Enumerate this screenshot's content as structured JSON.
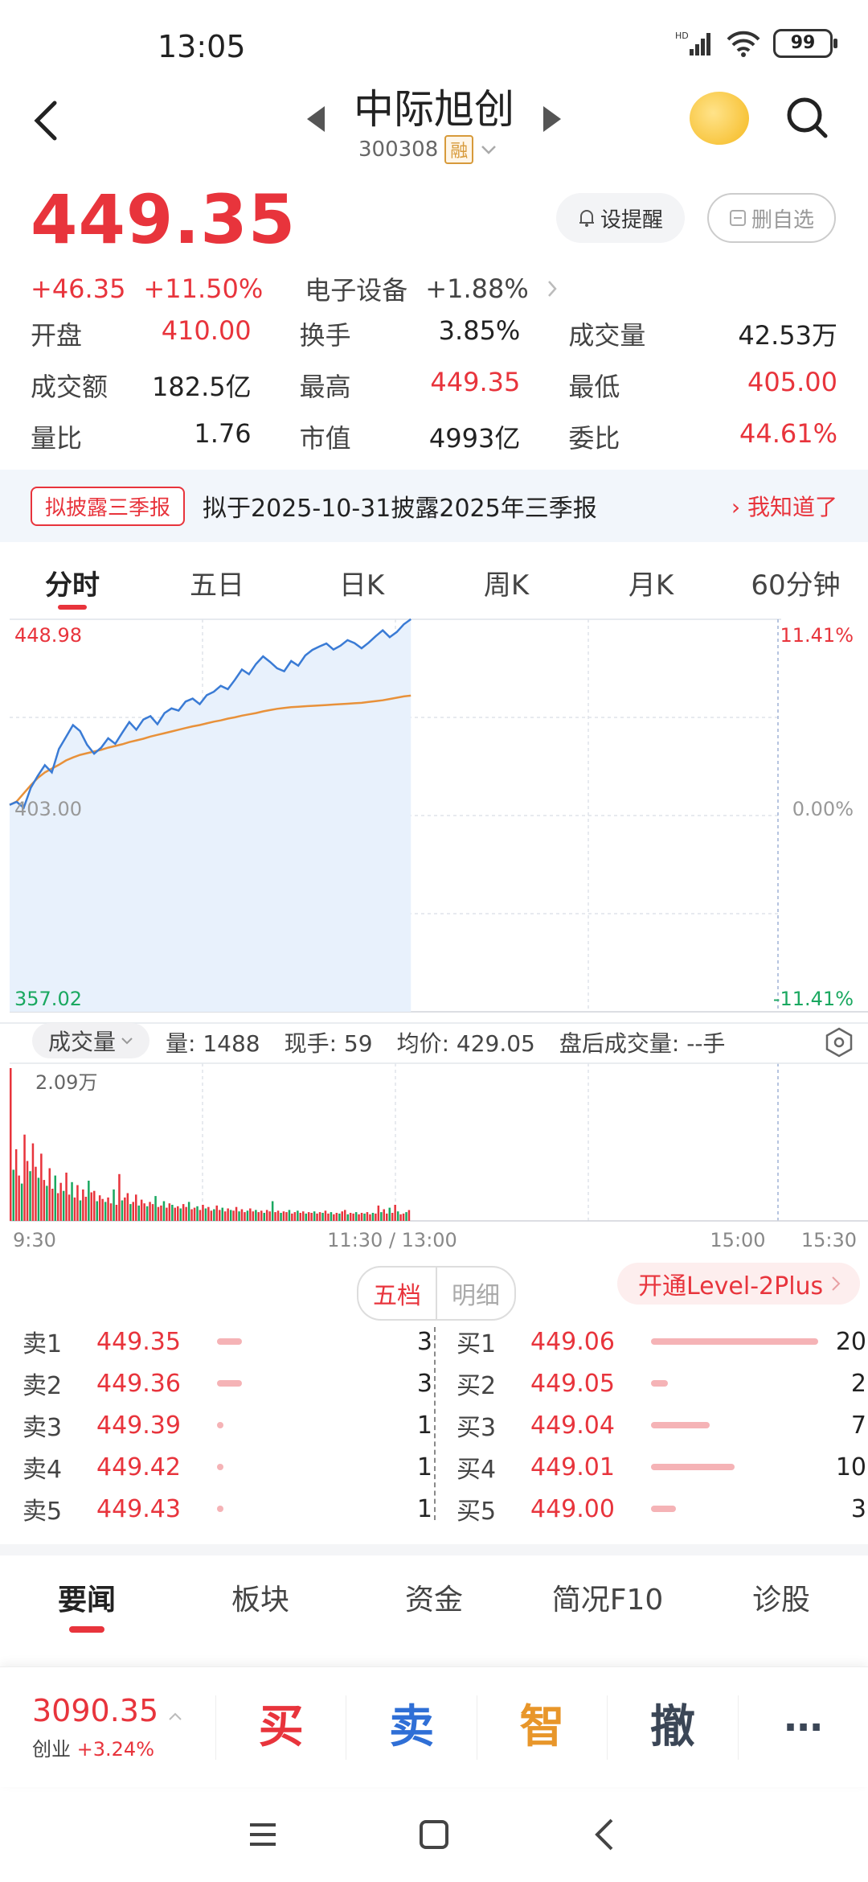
{
  "status_bar": {
    "time": "13:05",
    "battery": "99"
  },
  "header": {
    "name": "中际旭创",
    "code": "300308",
    "margin_tag": "融"
  },
  "quote": {
    "price": "449.35",
    "change": "+46.35",
    "change_pct": "+11.50%",
    "sector": "电子设备",
    "sector_change": "+1.88%",
    "alert_btn": "设提醒",
    "remove_btn": "删自选"
  },
  "stats": [
    {
      "label": "开盘",
      "value": "410.00",
      "color": "red"
    },
    {
      "label": "换手",
      "value": "3.85%",
      "color": "normal"
    },
    {
      "label": "成交量",
      "value": "42.53万",
      "color": "normal"
    },
    {
      "label": "成交额",
      "value": "182.5亿",
      "color": "normal"
    },
    {
      "label": "最高",
      "value": "449.35",
      "color": "red"
    },
    {
      "label": "最低",
      "value": "405.00",
      "color": "red"
    },
    {
      "label": "量比",
      "value": "1.76",
      "color": "normal"
    },
    {
      "label": "市值",
      "value": "4993亿",
      "color": "normal"
    },
    {
      "label": "委比",
      "value": "44.61%",
      "color": "red"
    }
  ],
  "notice": {
    "tag": "拟披露三季报",
    "text": "拟于2025-10-31披露2025年三季报",
    "link": "我知道了"
  },
  "tabs": [
    "分时",
    "五日",
    "日K",
    "周K",
    "月K",
    "60分钟"
  ],
  "chart_data": {
    "type": "line",
    "y_left_labels": [
      "448.98",
      "403.00",
      "357.02"
    ],
    "y_right_labels": [
      "11.41%",
      "0.00%",
      "-11.41%"
    ],
    "x_labels": [
      "9:30",
      "11:30 / 13:00",
      "15:00",
      "15:30"
    ],
    "ylim": [
      357.02,
      448.98
    ],
    "price_series": [
      405.5,
      406.2,
      404.8,
      409.5,
      412.3,
      414.8,
      413.1,
      418.6,
      421.4,
      424.2,
      422.8,
      419.6,
      417.5,
      418.9,
      421.1,
      419.8,
      422.4,
      424.9,
      423.1,
      425.5,
      426.3,
      424.4,
      427.0,
      428.1,
      427.6,
      429.7,
      430.4,
      429.1,
      431.2,
      432.0,
      433.4,
      432.6,
      434.8,
      437.2,
      436.1,
      438.5,
      440.3,
      439.0,
      437.5,
      436.8,
      439.2,
      438.1,
      440.5,
      441.8,
      442.6,
      443.3,
      441.9,
      442.8,
      444.1,
      443.4,
      442.2,
      443.5,
      445.0,
      446.4,
      444.8,
      446.0,
      447.8,
      449.0
    ],
    "avg_series": [
      405.5,
      406.3,
      408.2,
      410.1,
      411.8,
      413.1,
      414.0,
      414.9,
      415.9,
      416.6,
      417.2,
      417.6,
      418.0,
      418.4,
      418.9,
      419.3,
      419.7,
      420.2,
      420.6,
      421.0,
      421.5,
      421.9,
      422.3,
      422.7,
      423.1,
      423.5,
      423.9,
      424.2,
      424.6,
      425.0,
      425.3,
      425.7,
      426.0,
      426.4,
      426.7,
      427.0,
      427.4,
      427.7,
      428.0,
      428.2,
      428.4,
      428.5,
      428.6,
      428.7,
      428.8,
      428.9,
      429.0,
      429.1,
      429.2,
      429.3,
      429.4,
      429.6,
      429.8,
      430.0,
      430.3,
      430.6,
      430.9,
      431.1
    ],
    "volume_max_label": "2.09万",
    "volume_series": [
      20900,
      7000,
      9800,
      6200,
      5100,
      11800,
      8200,
      6800,
      10600,
      7400,
      5900,
      9200,
      5600,
      4800,
      7200,
      4400,
      6200,
      3800,
      5200,
      4100,
      6600,
      3600,
      5300,
      3200,
      4900,
      2800,
      4300,
      3300,
      5500,
      3900,
      4100,
      2700,
      3500,
      3000,
      2600,
      3200,
      2400,
      4300,
      2200,
      6400,
      2800,
      3200,
      3800,
      2300,
      2600,
      3600,
      2100,
      2900,
      2400,
      2000,
      2600,
      2300,
      3400,
      1900,
      2100,
      2700,
      1800,
      2400,
      2200,
      1800,
      2000,
      1700,
      2300,
      1900,
      2600,
      1600,
      1800,
      2000,
      1500,
      2200,
      1700,
      1900,
      1400,
      1600,
      2100,
      1500,
      1800,
      1300,
      1700,
      1500,
      1400,
      1900,
      1300,
      1600,
      1200,
      1400,
      1700,
      1300,
      1500,
      1200,
      1400,
      1100,
      1500,
      1300,
      2700,
      1200,
      1400,
      1100,
      1300,
      1200,
      1500,
      1000,
      1200,
      1400,
      1100,
      1300,
      1000,
      1200,
      1100,
      1300,
      1000,
      1200,
      1100,
      1400,
      1000,
      1200,
      900,
      1100,
      1000,
      1300,
      1500,
      900,
      1100,
      1000,
      1200,
      900,
      1100,
      1000,
      1200,
      900,
      1100,
      1000,
      2100,
      1200,
      1600,
      1000,
      1800,
      1100,
      2200,
      1300,
      900,
      1000,
      1200,
      1488
    ]
  },
  "volume_bar": {
    "filter": "成交量",
    "vol": "量: 1488",
    "hand": "现手: 59",
    "avg": "均价: 429.05",
    "after_hours": "盘后成交量: --手"
  },
  "orderbook": {
    "tab_active": "五档",
    "tab_other": "明细",
    "level2": "开通Level-2Plus",
    "asks": [
      {
        "label": "卖1",
        "price": "449.35",
        "qty": "3",
        "bar": 0.15
      },
      {
        "label": "卖2",
        "price": "449.36",
        "qty": "3",
        "bar": 0.15
      },
      {
        "label": "卖3",
        "price": "449.39",
        "qty": "1",
        "bar": 0.05
      },
      {
        "label": "卖4",
        "price": "449.42",
        "qty": "1",
        "bar": 0.05
      },
      {
        "label": "卖5",
        "price": "449.43",
        "qty": "1",
        "bar": 0.05
      }
    ],
    "bids": [
      {
        "label": "买1",
        "price": "449.06",
        "qty": "20",
        "bar": 1.0
      },
      {
        "label": "买2",
        "price": "449.05",
        "qty": "2",
        "bar": 0.1
      },
      {
        "label": "买3",
        "price": "449.04",
        "qty": "7",
        "bar": 0.35
      },
      {
        "label": "买4",
        "price": "449.01",
        "qty": "10",
        "bar": 0.5
      },
      {
        "label": "买5",
        "price": "449.00",
        "qty": "3",
        "bar": 0.15
      }
    ]
  },
  "news_tabs": [
    "要闻",
    "板块",
    "资金",
    "简况F10",
    "诊股"
  ],
  "action_bar": {
    "index_value": "3090.35",
    "index_name": "创业",
    "index_change": "+3.24%",
    "buy": "买",
    "sell": "卖",
    "smart": "智",
    "cancel": "撤",
    "more": "⋯"
  },
  "colors": {
    "up": "#e8343c",
    "down": "#1aa860",
    "price_line": "#3a7bd5",
    "avg_line": "#e8913a"
  }
}
